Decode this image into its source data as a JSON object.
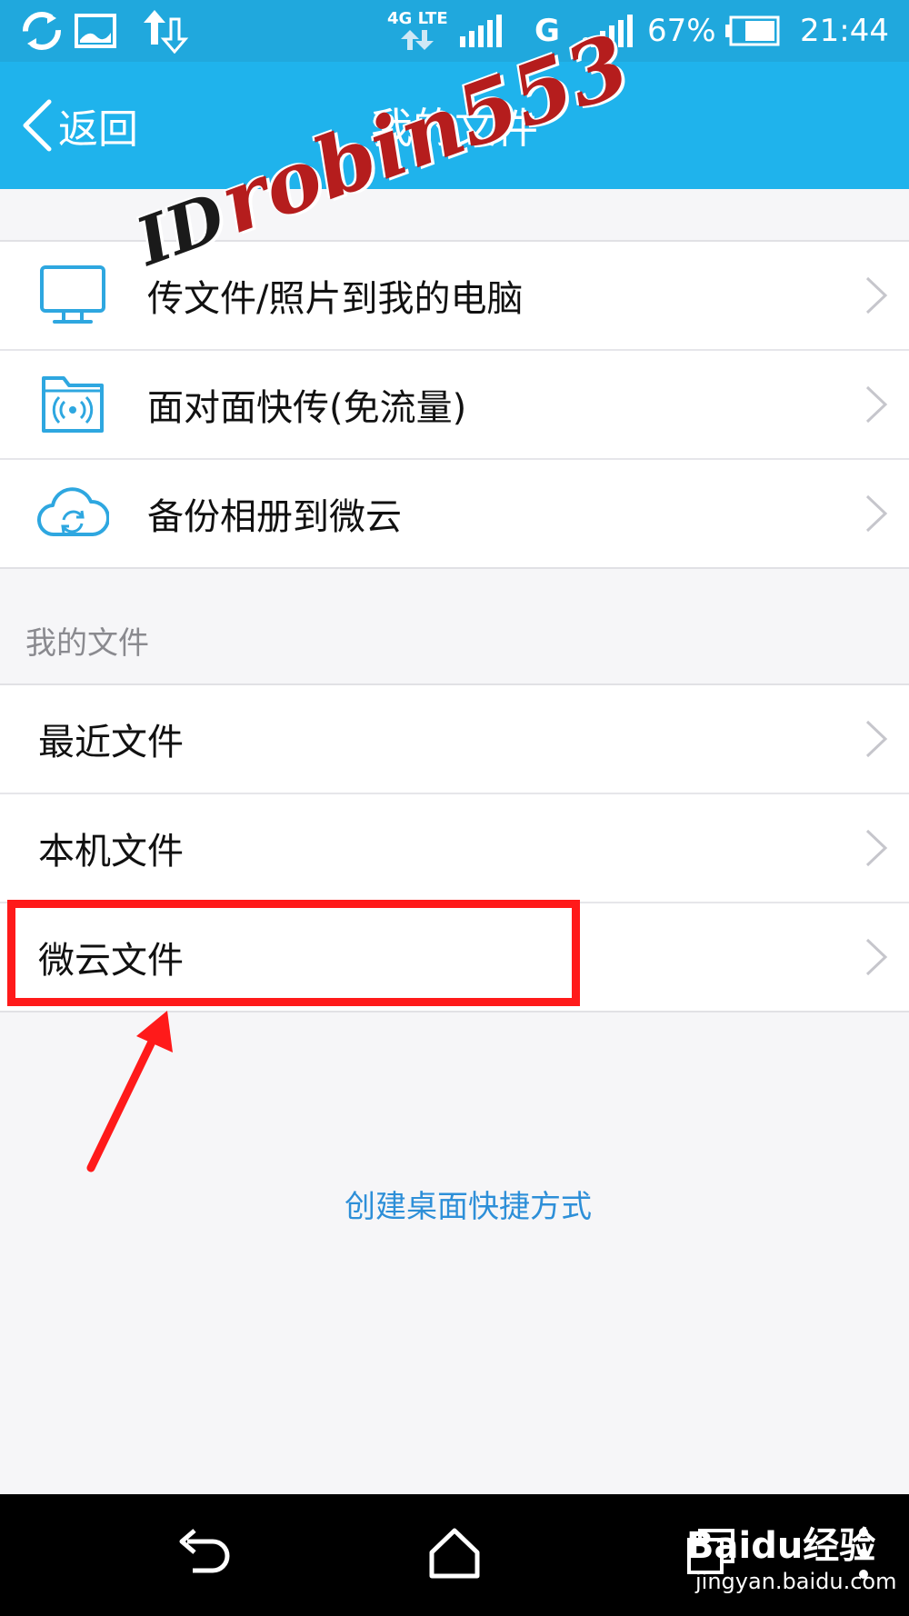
{
  "status_bar": {
    "network_label": "4G LTE",
    "carrier_mark": "G",
    "battery_percent": "67%",
    "time": "21:44"
  },
  "header": {
    "back_label": "返回",
    "title": "我的文件"
  },
  "quick_actions": [
    {
      "label": "传文件/照片到我的电脑",
      "icon": "monitor-icon"
    },
    {
      "label": "面对面快传(免流量)",
      "icon": "wifi-folder-icon"
    },
    {
      "label": "备份相册到微云",
      "icon": "cloud-sync-icon"
    }
  ],
  "my_files": {
    "section_label": "我的文件",
    "items": [
      {
        "label": "最近文件"
      },
      {
        "label": "本机文件"
      },
      {
        "label": "微云文件"
      }
    ]
  },
  "shortcut_link": "创建桌面快捷方式",
  "watermark": {
    "prefix": "ID",
    "name": "robin553"
  },
  "baidu": {
    "logo": "Baidu经验",
    "url": "jingyan.baidu.com"
  },
  "colors": {
    "header_bg": "#1fb3ec",
    "statusbar_bg": "#20a8dd",
    "icon_accent": "#2ea7e0",
    "link": "#2d8fd8",
    "highlight": "#ff1a1a"
  }
}
